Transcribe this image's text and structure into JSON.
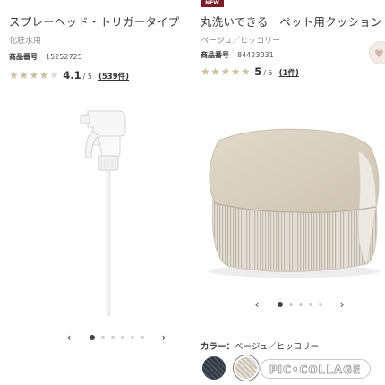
{
  "products": [
    {
      "title": "スプレーヘッド・トリガータイプ",
      "subtitle": "化粧水用",
      "product_number_label": "商品番号",
      "product_number": "15252725",
      "rating": {
        "stars": 4,
        "score": "4.1",
        "out_of": "/ 5",
        "reviews": "(539件)"
      },
      "pager": {
        "total": 6,
        "active": 0
      }
    },
    {
      "badge": "NEW",
      "title": "丸洗いできる　ペット用クッション",
      "subtitle": "ベージュ／ヒッコリー",
      "product_number_label": "商品番号",
      "product_number": "84423031",
      "rating": {
        "stars": 5,
        "score": "5",
        "out_of": "/ 5",
        "reviews": "(1件)"
      },
      "pager": {
        "total": 5,
        "active": 0
      },
      "color_label_key": "カラー：",
      "color_label_value": "ベージュ／ヒッコリー",
      "swatches": [
        {
          "name": "navy-hickory",
          "color": "#2f3640",
          "selected": false
        },
        {
          "name": "beige-hickory",
          "color": "#c9c0b4",
          "selected": true
        }
      ]
    }
  ],
  "icons": {
    "prev": "‹",
    "next": "›",
    "star": "★",
    "favorite": "heart-icon"
  },
  "watermark": "PIC•COLLAGE"
}
